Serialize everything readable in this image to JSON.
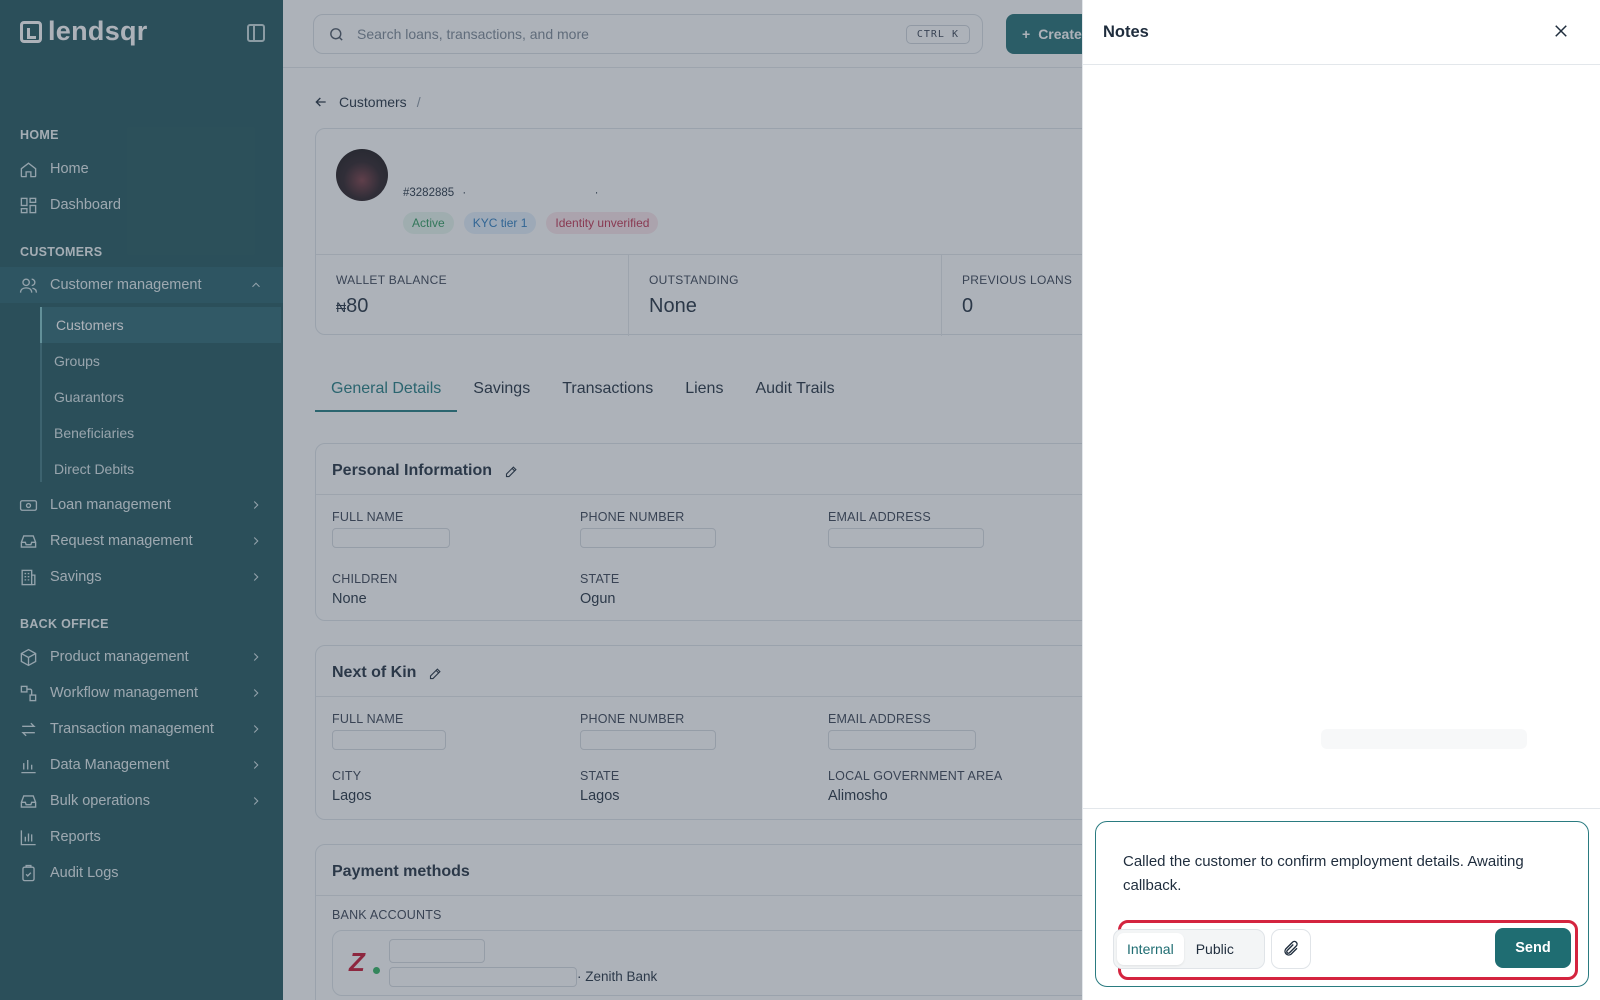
{
  "brand": {
    "name": "lendsqr"
  },
  "sidebar": {
    "sections": [
      {
        "title": "HOME"
      },
      {
        "title": "CUSTOMERS"
      },
      {
        "title": "BACK OFFICE"
      }
    ],
    "home_items": [
      {
        "label": "Home",
        "icon": "home-icon"
      },
      {
        "label": "Dashboard",
        "icon": "dashboard-icon"
      }
    ],
    "customer_management": {
      "label": "Customer management",
      "expanded": true
    },
    "customer_subitems": [
      {
        "label": "Customers",
        "active": true
      },
      {
        "label": "Groups"
      },
      {
        "label": "Guarantors"
      },
      {
        "label": "Beneficiaries"
      },
      {
        "label": "Direct Debits"
      }
    ],
    "customer_items": [
      {
        "label": "Loan management"
      },
      {
        "label": "Request management"
      },
      {
        "label": "Savings"
      }
    ],
    "backoffice_items": [
      {
        "label": "Product management"
      },
      {
        "label": "Workflow management"
      },
      {
        "label": "Transaction management"
      },
      {
        "label": "Data Management"
      },
      {
        "label": "Bulk operations"
      },
      {
        "label": "Reports"
      },
      {
        "label": "Audit Logs"
      }
    ]
  },
  "topbar": {
    "search_placeholder": "Search loans, transactions, and more",
    "shortcut": "CTRL K",
    "create_label": "Create"
  },
  "breadcrumb": {
    "parent": "Customers",
    "separator": "/"
  },
  "profile": {
    "customer_id": "#3282885",
    "badges": [
      "Active",
      "KYC tier 1",
      "Identity unverified"
    ],
    "stats": [
      {
        "label": "WALLET BALANCE",
        "currency": "₦",
        "value": "80"
      },
      {
        "label": "OUTSTANDING",
        "value": "None"
      },
      {
        "label": "PREVIOUS LOANS",
        "value": "0"
      }
    ]
  },
  "tabs": [
    "General Details",
    "Savings",
    "Transactions",
    "Liens",
    "Audit Trails"
  ],
  "personal_info": {
    "title": "Personal Information",
    "labels": {
      "full_name": "FULL NAME",
      "phone": "PHONE NUMBER",
      "email": "EMAIL ADDRESS",
      "children": "CHILDREN",
      "state": "STATE"
    },
    "values": {
      "children": "None",
      "state": "Ogun"
    }
  },
  "next_of_kin": {
    "title": "Next of Kin",
    "labels": {
      "full_name": "FULL NAME",
      "phone": "PHONE NUMBER",
      "email": "EMAIL ADDRESS",
      "city": "CITY",
      "state": "STATE",
      "lga": "LOCAL GOVERNMENT AREA"
    },
    "values": {
      "city": "Lagos",
      "state": "Lagos",
      "lga": "Alimosho"
    }
  },
  "payment_methods": {
    "title": "Payment methods",
    "bank_accounts_label": "BANK ACCOUNTS",
    "bank_name": "· Zenith Bank"
  },
  "notes": {
    "title": "Notes",
    "draft": "Called the customer to confirm employment details. Awaiting callback.",
    "visibility_options": [
      "Internal",
      "Public"
    ],
    "selected_visibility": "Internal",
    "send_label": "Send"
  }
}
